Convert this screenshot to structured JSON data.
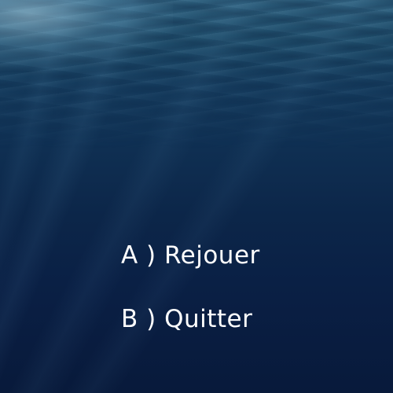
{
  "menu": {
    "options": [
      {
        "label": "A ) Rejouer"
      },
      {
        "label": "B ) Quitter"
      }
    ]
  },
  "colors": {
    "text": "#ffffff",
    "water_top": "#2a5a78",
    "water_bottom": "#081a3b"
  }
}
